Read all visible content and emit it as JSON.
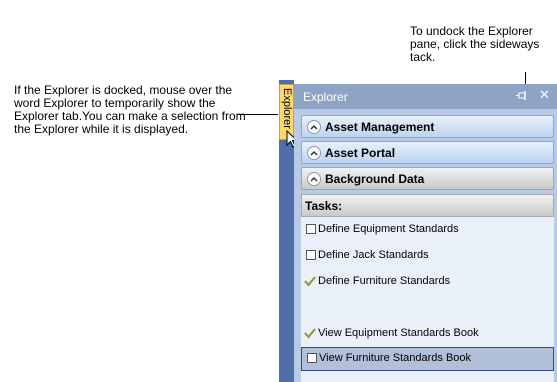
{
  "callouts": {
    "left": "If the Explorer is docked, mouse over the word Explorer to temporarily show the Explorer tab.You can make a selection from the Explorer while it is displayed.",
    "right": "To undock the Explorer pane, click the sideways tack."
  },
  "dock_tab": {
    "label": "Explorer"
  },
  "explorer": {
    "title": "Explorer",
    "sections": [
      {
        "label": "Asset Management"
      },
      {
        "label": "Asset Portal"
      },
      {
        "label": "Background Data"
      }
    ],
    "tasks_header": "Tasks:",
    "tasks": [
      {
        "label": "Define Equipment Standards",
        "icon": "checkbox-icon"
      },
      {
        "label": "Define Jack Standards",
        "icon": "checkbox-icon"
      },
      {
        "label": "Define Furniture Standards",
        "icon": "checkmark-icon"
      },
      {
        "label": "View Equipment Standards Book",
        "icon": "checkmark-icon"
      },
      {
        "label": "View Furniture Standards Book",
        "icon": "checkbox-icon",
        "selected": true
      }
    ]
  },
  "colors": {
    "header": "#8fa4c4",
    "pane": "#b7cbe8",
    "dock_strip": "#4f6ea8",
    "dock_tab": "#ffd869",
    "selection": "#b2bfd9"
  }
}
